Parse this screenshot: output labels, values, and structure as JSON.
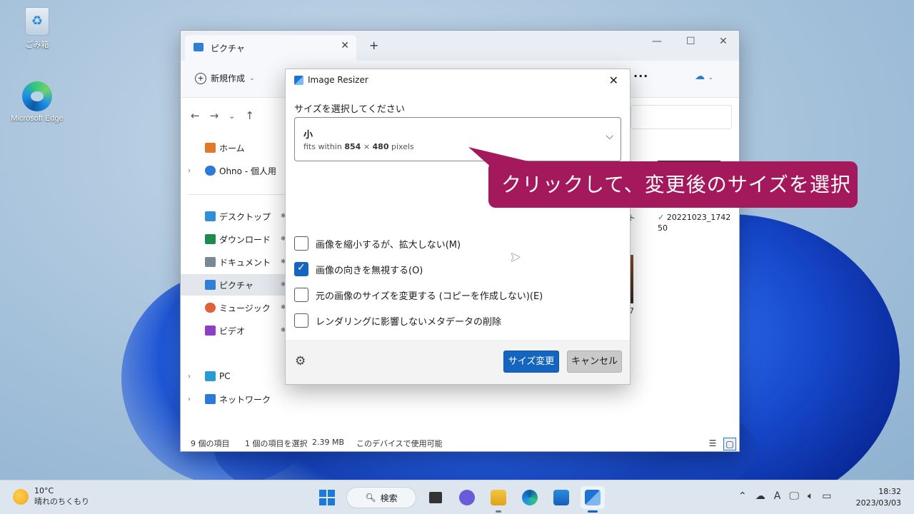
{
  "desktop": {
    "icons": [
      {
        "label": "ごみ箱",
        "icon": "recycle-bin-icon"
      },
      {
        "label": "Microsoft Edge",
        "icon": "edge-icon"
      }
    ]
  },
  "explorer": {
    "tab_title": "ピクチャ",
    "toolbar": {
      "new_label": "新規作成"
    },
    "sidebar": [
      {
        "label": "ホーム",
        "icon": "home-icon",
        "color": "#e07a2a"
      },
      {
        "label": "Ohno - 個人用",
        "icon": "onedrive-icon",
        "color": "#2a7ad6",
        "expandable": true
      },
      {
        "label": "デスクトップ",
        "icon": "desktop-icon",
        "color": "#2f8fd8",
        "pinned": true
      },
      {
        "label": "ダウンロード",
        "icon": "download-icon",
        "color": "#1f8a4c",
        "pinned": true
      },
      {
        "label": "ドキュメント",
        "icon": "document-icon",
        "color": "#7a8896",
        "pinned": true
      },
      {
        "label": "ピクチャ",
        "icon": "pictures-icon",
        "color": "#2f7fd7",
        "pinned": true,
        "selected": true
      },
      {
        "label": "ミュージック",
        "icon": "music-icon",
        "color": "#e0603a",
        "pinned": true
      },
      {
        "label": "ビデオ",
        "icon": "video-icon",
        "color": "#8b3fc4",
        "pinned": true
      },
      {
        "label": "PC",
        "icon": "pc-icon",
        "color": "#2a9ad6",
        "expandable": true
      },
      {
        "label": "ネットワーク",
        "icon": "network-icon",
        "color": "#2a7ad6",
        "expandable": true
      }
    ],
    "file_caption_line1": "20221023_1742",
    "file_caption_line2": "50",
    "partial_text_1": "ト",
    "partial_text_2": "7",
    "status": {
      "item_count": "9 個の項目",
      "selected": "1 個の項目を選択",
      "size": "2.39 MB",
      "availability": "このデバイスで使用可能"
    }
  },
  "dialog": {
    "title": "Image Resizer",
    "size_prompt": "サイズを選択してください",
    "selected_size": {
      "name": "小",
      "desc_prefix": "fits within",
      "width": "854",
      "times": "×",
      "height": "480",
      "unit": "pixels"
    },
    "options": [
      {
        "label": "画像を縮小するが、拡大しない(M)",
        "checked": false
      },
      {
        "label": "画像の向きを無視する(O)",
        "checked": true
      },
      {
        "label": "元の画像のサイズを変更する (コピーを作成しない)(E)",
        "checked": false
      },
      {
        "label": "レンダリングに影響しないメタデータの削除",
        "checked": false
      }
    ],
    "resize_button": "サイズ変更",
    "cancel_button": "キャンセル"
  },
  "callout": {
    "text": "クリックして、変更後のサイズを選択",
    "color": "#a4195b"
  },
  "taskbar": {
    "weather_temp": "10°C",
    "weather_text": "晴れのちくもり",
    "search_label": "検索",
    "time": "18:32",
    "date": "2023/03/03",
    "ime_indicator": "A"
  }
}
